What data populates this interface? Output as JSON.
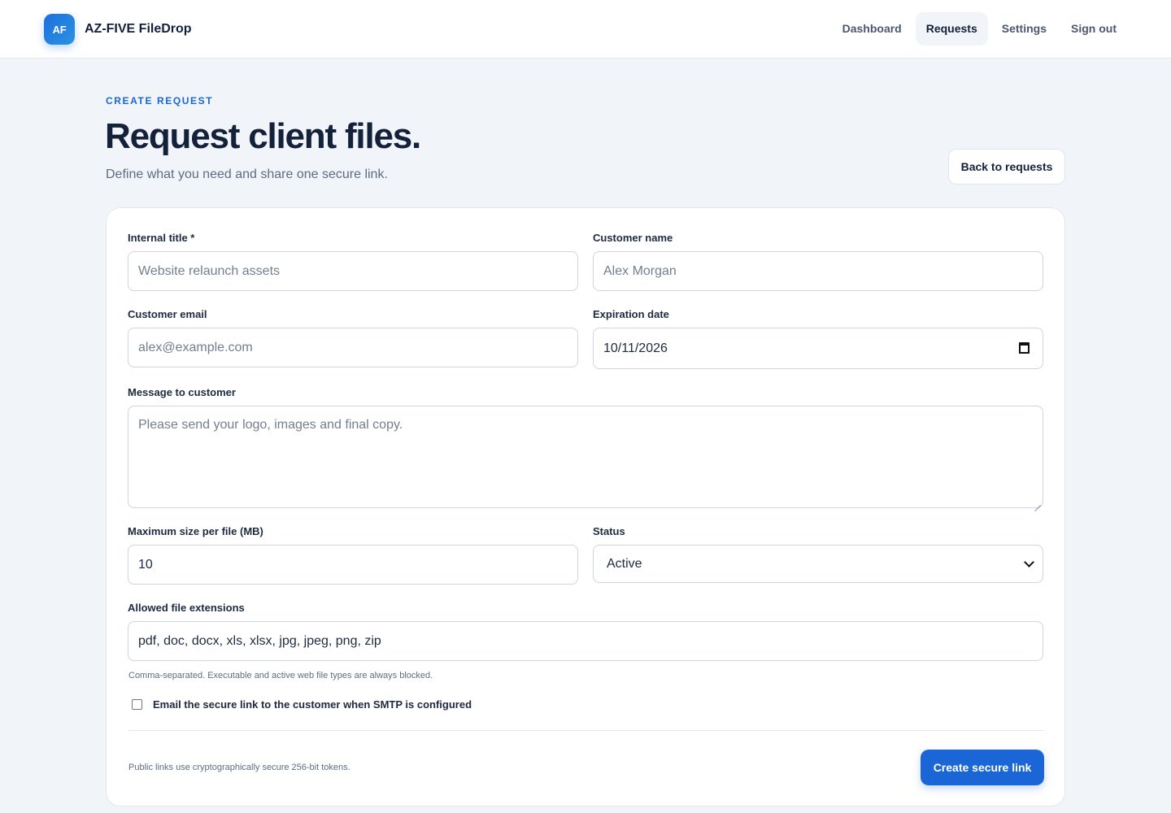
{
  "brand": {
    "logo_text": "AF",
    "name": "AZ-FIVE FileDrop"
  },
  "nav": {
    "dashboard": "Dashboard",
    "requests": "Requests",
    "settings": "Settings",
    "sign_out": "Sign out",
    "active": "Requests"
  },
  "page": {
    "eyebrow": "CREATE REQUEST",
    "title": "Request client files.",
    "subtitle": "Define what you need and share one secure link.",
    "back_button": "Back to requests"
  },
  "form": {
    "internal_title": {
      "label": "Internal title *",
      "placeholder": "Website relaunch assets",
      "value": ""
    },
    "customer_name": {
      "label": "Customer name",
      "placeholder": "Alex Morgan",
      "value": ""
    },
    "customer_email": {
      "label": "Customer email",
      "placeholder": "alex@example.com",
      "value": ""
    },
    "expiration_date": {
      "label": "Expiration date",
      "value": "10/11/2026",
      "icon": "calendar-icon"
    },
    "message": {
      "label": "Message to customer",
      "placeholder": "Please send your logo, images and final copy.",
      "value": ""
    },
    "max_size": {
      "label": "Maximum size per file (MB)",
      "value": "10"
    },
    "status": {
      "label": "Status",
      "value": "Active",
      "icon": "chevron-down-icon"
    },
    "extensions": {
      "label": "Allowed file extensions",
      "value": "pdf, doc, docx, xls, xlsx, jpg, jpeg, png, zip"
    },
    "extensions_hint": "Comma-separated. Executable and active web file types are always blocked.",
    "email_checkbox": {
      "label": "Email the secure link to the customer when SMTP is configured",
      "checked": false
    },
    "footer_note": "Public links use cryptographically secure 256-bit tokens.",
    "submit_label": "Create secure link"
  },
  "colors": {
    "accent": "#1a66d6",
    "background": "#f1f5fa",
    "text": "#14213a"
  }
}
